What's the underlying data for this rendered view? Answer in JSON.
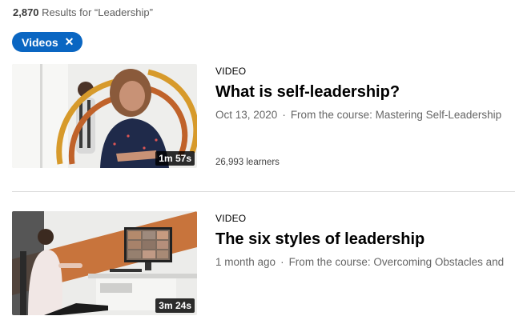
{
  "search": {
    "count": "2,870",
    "text": "Results for “Leadership”"
  },
  "filter": {
    "label": "Videos",
    "close_glyph": "✕"
  },
  "results": [
    {
      "type": "VIDEO",
      "title": "What is self-leadership?",
      "date": "Oct 13, 2020",
      "separator": "·",
      "course": "From the course: Mastering Self-Leadership",
      "learners": "26,993 learners",
      "duration": "1m 57s",
      "thumbnail": {
        "bg": "#f2f2f0",
        "accent": "#d79a2b",
        "accent2": "#c0622a"
      }
    },
    {
      "type": "VIDEO",
      "title": "The six styles of leadership",
      "date": "1 month ago",
      "separator": "·",
      "course": "From the course: Overcoming Obstacles and",
      "duration": "3m 24s",
      "thumbnail": {
        "bg": "#e9e9e7",
        "accent": "#c8743c"
      }
    }
  ]
}
